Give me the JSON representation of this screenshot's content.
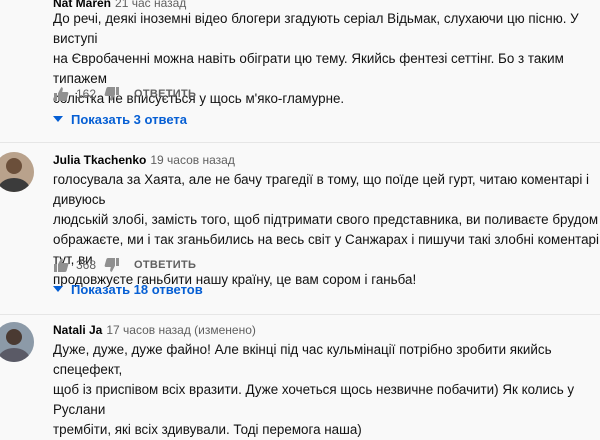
{
  "comments": [
    {
      "author": "Nat Maren",
      "time": "21 час назад",
      "lines": [
        "До речі, деякі іноземні відео блогери згадують серіал Відьмак, слухаючи цю пісню. У виступі",
        "на Євробаченні можна навіть обіграти цю тему. Якийсь фентезі сеттінг. Бо з таким типажем",
        "солістка не вписується у щось м'яко-гламурне."
      ],
      "likes": "162",
      "reply_label": "ОТВЕТИТЬ",
      "replies_label": "Показать 3 ответа"
    },
    {
      "author": "Julia Tkachenko",
      "time": "19 часов назад",
      "lines": [
        "голосувала за Хаята, але не бачу трагедії в тому, що поїде цей гурт, читаю коментарі і дивуюсь",
        "людській злобі, замість того, щоб підтримати свого представника, ви поливаєте брудом і",
        "ображаєте, ми і так зганьбились на весь світ у Санжарах і пишучи такі злобні коментарі тут, ви",
        "продовжуєте ганьбити нашу країну, це вам сором і ганьба!"
      ],
      "likes": "368",
      "reply_label": "ОТВЕТИТЬ",
      "replies_label": "Показать 18 ответов"
    },
    {
      "author": "Natali Ja",
      "time": "17 часов назад (изменено)",
      "lines": [
        "Дуже, дуже, дуже файно! Але вкінці під час кульмінації потрібно зробити якийсь спецефект,",
        "щоб із приспівом всіх вразити. Дуже хочеться щось незвичне побачити) Як колись у Руслани",
        "трембіти, які всіх здивували. Тоді перемога наша)"
      ]
    }
  ],
  "colors": {
    "link": "#065fd4",
    "meta": "#606060",
    "background": "#f9f9f9"
  },
  "icons": {
    "like": "thumb-up-icon",
    "dislike": "thumb-down-icon",
    "expand": "caret-down-icon"
  }
}
